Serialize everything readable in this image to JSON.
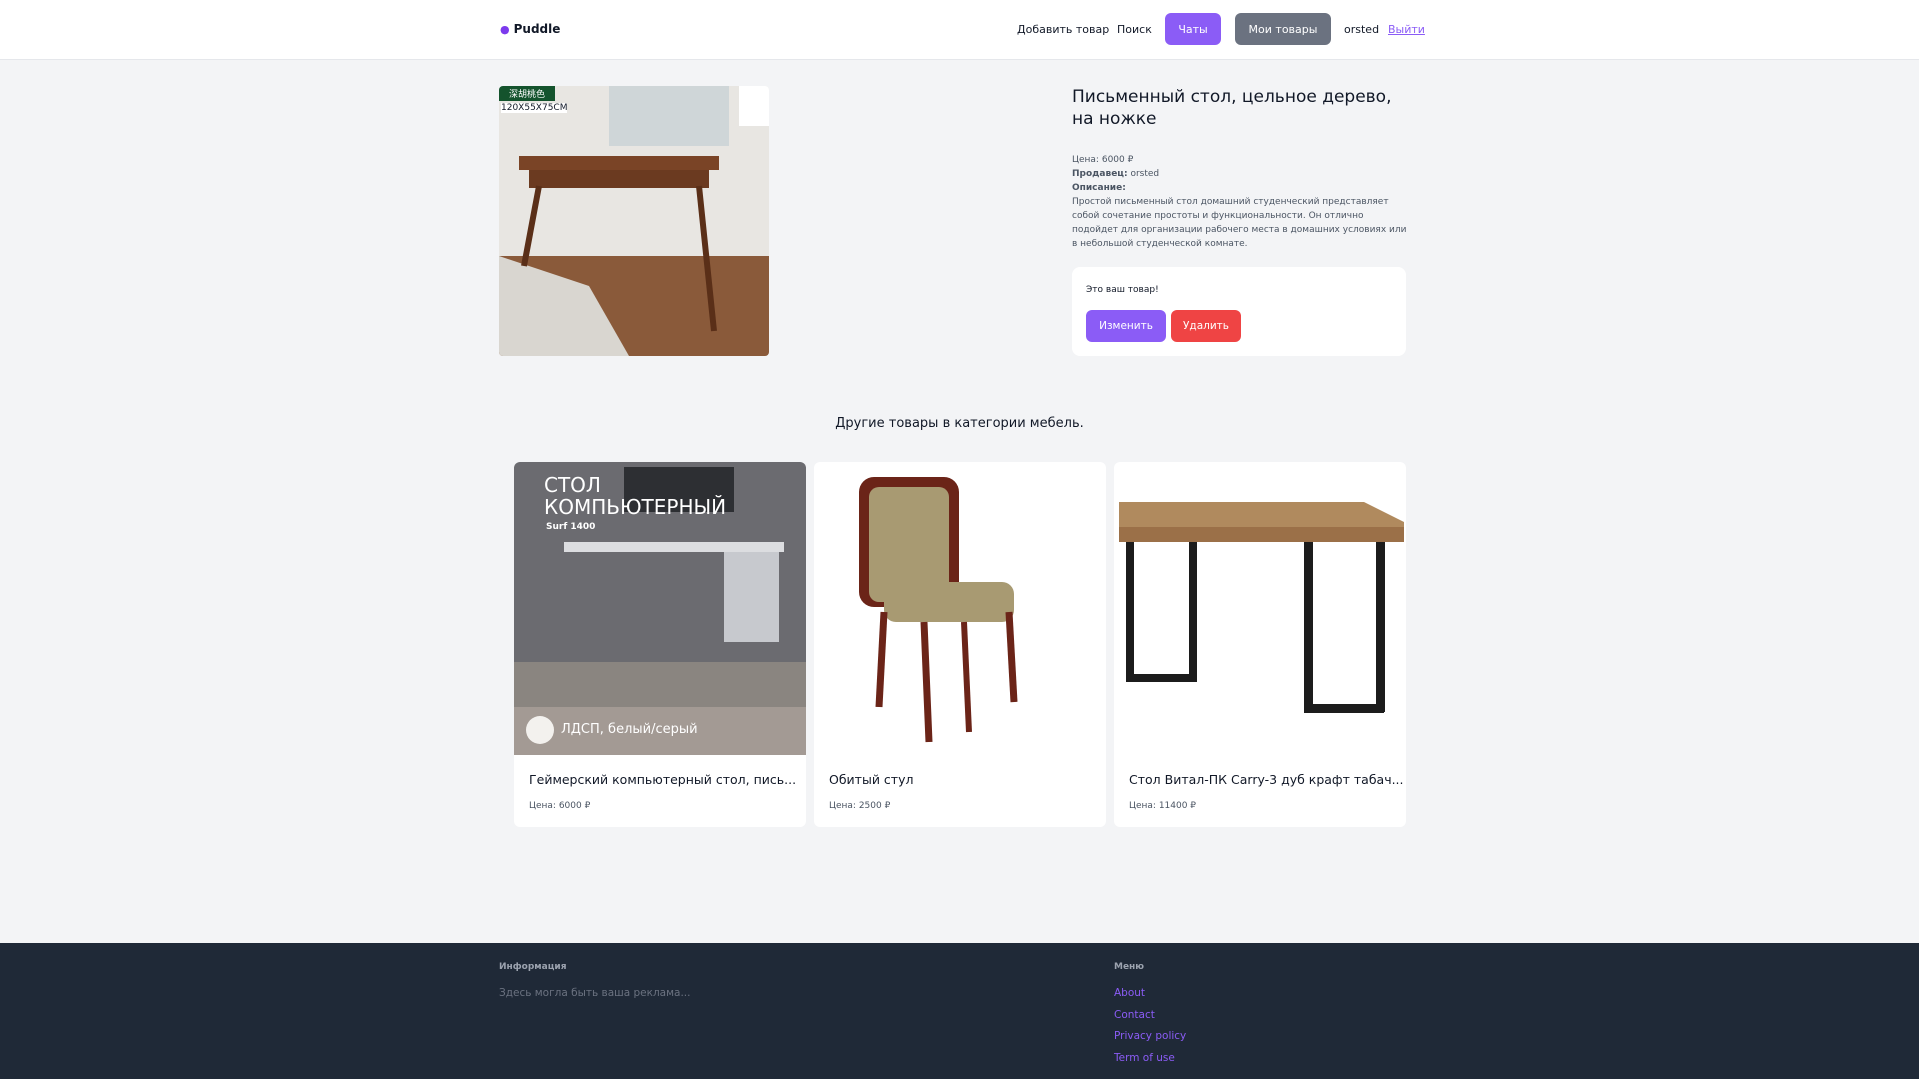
{
  "header": {
    "logo": "Puddle",
    "nav": {
      "add": "Добавить товар",
      "search": "Поиск",
      "chats": "Чаты",
      "my_items": "Мои товары",
      "user": "orsted",
      "logout": "Выйти"
    }
  },
  "product": {
    "title": "Письменный стол, цельное дерево, на ножке",
    "image_label": "深胡桃色",
    "image_size": "120X55X75CM",
    "price_label": "Цена:",
    "price": "6000 ₽",
    "seller_label": "Продавец:",
    "seller": "orsted",
    "description_label": "Описание:",
    "description": "Простой письменный стол домашний студенческий представляет собой сочетание простоты и функциональности. Он отлично подойдет для организации рабочего места в домашних условиях или в небольшой студенческой комнате."
  },
  "owner_box": {
    "text": "Это ваш товар!",
    "edit": "Изменить",
    "delete": "Удалить"
  },
  "related": {
    "heading": "Другие товары в категории мебель.",
    "items": [
      {
        "title": "Геймерский компьютерный стол, пись...",
        "price": "Цена: 6000 ₽",
        "img_title": "СТОЛ КОМПЬЮТЕРНЫЙ",
        "img_sub": "Surf 1400",
        "img_caption": "ЛДСП, белый/серый"
      },
      {
        "title": "Обитый стул",
        "price": "Цена: 2500 ₽"
      },
      {
        "title": "Стол Витал-ПК Carry-3 дуб крафт табач...",
        "price": "Цена: 11400 ₽"
      }
    ]
  },
  "footer": {
    "info_heading": "Информация",
    "info_text": "Здесь могла быть ваша реклама...",
    "menu_heading": "Меню",
    "links": [
      "About",
      "Contact",
      "Privacy policy",
      "Term of use"
    ]
  },
  "colors": {
    "accent": "#8b5cf6",
    "danger": "#ef4444",
    "gray_button": "#6b7280",
    "footer_bg": "#1f2937"
  }
}
